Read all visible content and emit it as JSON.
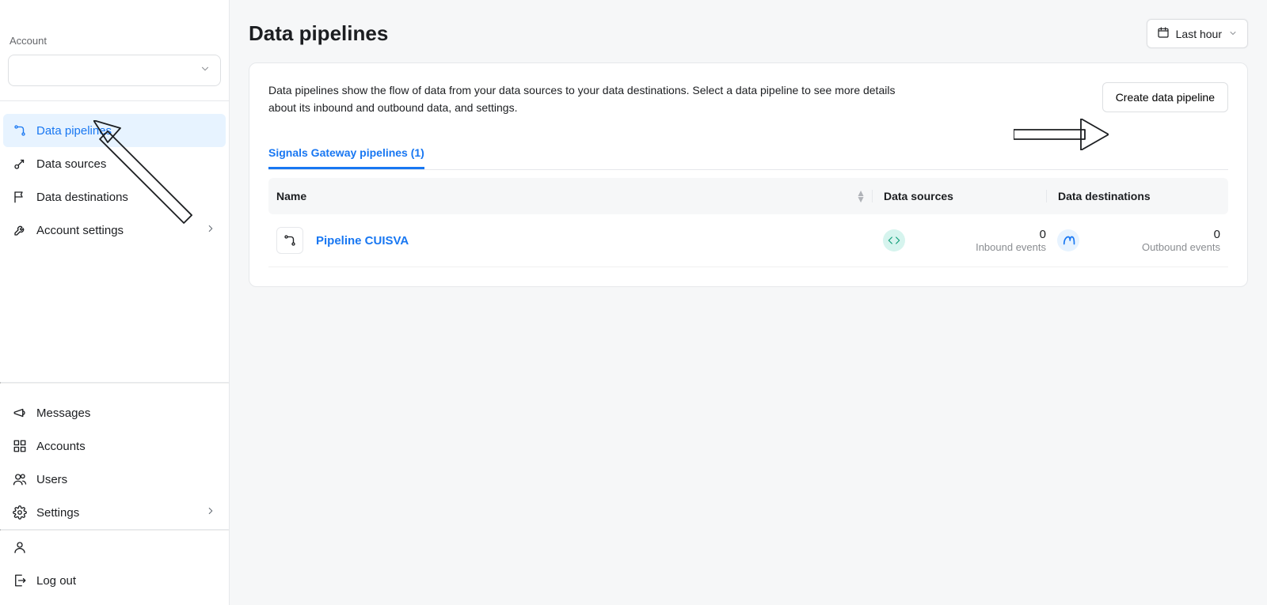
{
  "sidebar": {
    "account_label": "Account",
    "nav_primary": [
      {
        "key": "pipelines",
        "label": "Data pipelines"
      },
      {
        "key": "sources",
        "label": "Data sources"
      },
      {
        "key": "destinations",
        "label": "Data destinations"
      },
      {
        "key": "settings",
        "label": "Account settings"
      }
    ],
    "nav_secondary": [
      {
        "key": "messages",
        "label": "Messages"
      },
      {
        "key": "accounts",
        "label": "Accounts"
      },
      {
        "key": "users",
        "label": "Users"
      },
      {
        "key": "settings2",
        "label": "Settings"
      }
    ],
    "nav_footer": [
      {
        "key": "profile",
        "label": ""
      },
      {
        "key": "logout",
        "label": "Log out"
      }
    ]
  },
  "header": {
    "title": "Data pipelines",
    "time_filter": "Last hour"
  },
  "card": {
    "description": "Data pipelines show the flow of data from your data sources to your data destinations. Select a data pipeline to see more details about its inbound and outbound data, and settings.",
    "create_btn": "Create data pipeline",
    "tab_label": "Signals Gateway pipelines (1)"
  },
  "table": {
    "columns": {
      "name": "Name",
      "sources": "Data sources",
      "destinations": "Data destinations"
    },
    "rows": [
      {
        "name": "Pipeline CUISVA",
        "inbound_count": "0",
        "inbound_label": "Inbound events",
        "outbound_count": "0",
        "outbound_label": "Outbound events"
      }
    ]
  }
}
